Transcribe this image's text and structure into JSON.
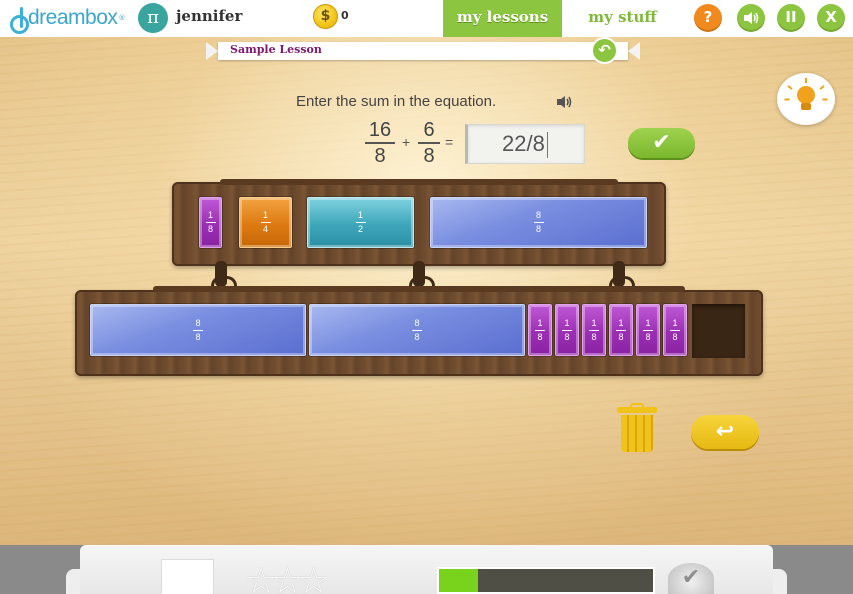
{
  "header": {
    "brand": "dreambox",
    "brand_tm": "®",
    "avatar_glyph": "π",
    "username": "jennifer",
    "coin_glyph": "$",
    "coins": "0",
    "tabs": [
      {
        "label": "my lessons",
        "active": true
      },
      {
        "label": "my stuff",
        "active": false
      }
    ],
    "buttons": {
      "help": "?",
      "sound": "◀))",
      "pause": "II",
      "close": "X"
    },
    "colors": {
      "accent_green": "#8cc53f",
      "help_orange": "#f08a1c",
      "brand_blue": "#3aa6cf"
    }
  },
  "lesson": {
    "title": "Sample Lesson",
    "back_glyph": "↶",
    "prompt": "Enter the sum in the equation.",
    "equation": {
      "left": {
        "num": "16",
        "den": "8"
      },
      "op_plus": "+",
      "right": {
        "num": "6",
        "den": "8"
      },
      "op_equals": "=",
      "answer_value": "22/8"
    },
    "check_glyph": "✔",
    "reset_glyph": "↩",
    "top_shelf_tiles": [
      {
        "num": "1",
        "den": "8",
        "color": "purple"
      },
      {
        "num": "1",
        "den": "4",
        "color": "orange"
      },
      {
        "num": "1",
        "den": "2",
        "color": "teal"
      },
      {
        "num": "8",
        "den": "8",
        "color": "blue"
      }
    ],
    "bottom_shelf_tiles": [
      {
        "num": "8",
        "den": "8",
        "color": "blue"
      },
      {
        "num": "8",
        "den": "8",
        "color": "blue"
      },
      {
        "num": "1",
        "den": "8",
        "color": "purple"
      },
      {
        "num": "1",
        "den": "8",
        "color": "purple"
      },
      {
        "num": "1",
        "den": "8",
        "color": "purple"
      },
      {
        "num": "1",
        "den": "8",
        "color": "purple"
      },
      {
        "num": "1",
        "den": "8",
        "color": "purple"
      },
      {
        "num": "1",
        "den": "8",
        "color": "purple"
      }
    ]
  },
  "footer": {
    "stars_glyph": "☆☆☆",
    "stars_earned": 0,
    "stars_total": 3,
    "progress_fraction": 0.18,
    "done_glyph": "✔"
  }
}
